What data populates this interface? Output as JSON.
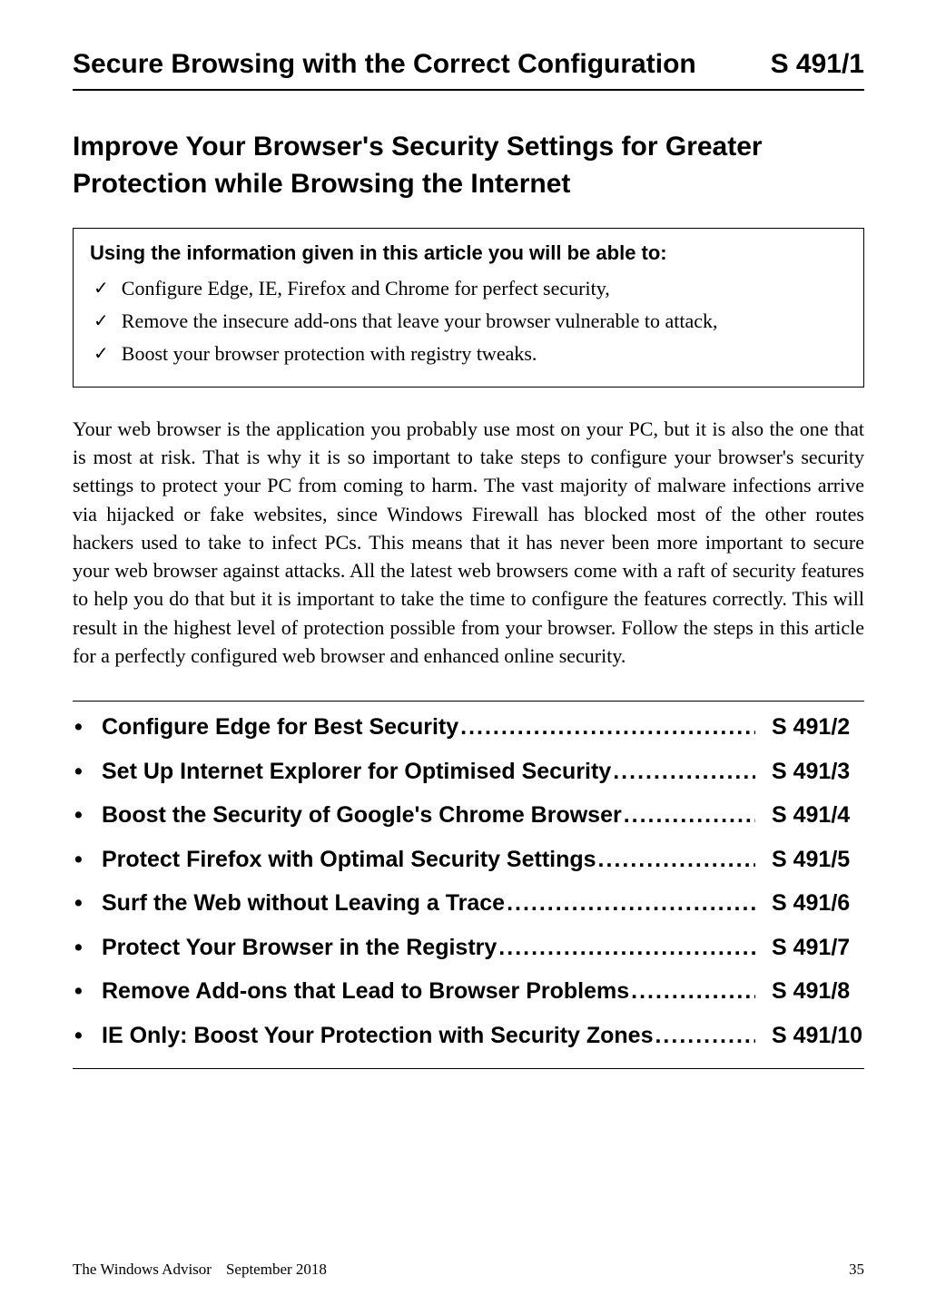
{
  "header": {
    "title": "Secure Browsing with the Correct Configuration",
    "code": "S 491/1"
  },
  "article_title": "Improve Your Browser's Security Settings for Greater Protection while Browsing the Internet",
  "info_box": {
    "title": "Using the information given in this article you will be able to:",
    "items": [
      "Configure Edge, IE, Firefox and Chrome for perfect security,",
      "Remove the insecure add-ons that leave your browser vulnerable to attack,",
      "Boost your browser protection with registry tweaks."
    ]
  },
  "body": "Your web browser is the application you probably use most on your PC, but it is also the one that is most at risk. That is why it is so important to take steps to configure your browser's security settings to protect your PC from coming to harm. The vast majority of malware infections arrive via hijacked or fake websites, since Windows Firewall has blocked most of the other routes hackers used to take to infect PCs. This means that it has never been more important to secure your web browser against attacks. All the latest web browsers come with a raft of security features to help you do that but it is important to take the time to configure the features correctly. This will result in the highest level of protection possible from your browser. Follow the steps in this article for a perfectly configured web browser and enhanced online security.",
  "toc": [
    {
      "label": "Configure Edge for Best Security",
      "page": "S 491/2"
    },
    {
      "label": "Set Up Internet Explorer for Optimised Security",
      "page": "S 491/3"
    },
    {
      "label": "Boost the Security of Google's Chrome Browser",
      "page": "S 491/4"
    },
    {
      "label": "Protect Firefox with Optimal Security Settings",
      "page": "S 491/5"
    },
    {
      "label": "Surf the Web without Leaving a Trace",
      "page": "S 491/6"
    },
    {
      "label": "Protect Your Browser in the Registry",
      "page": "S 491/7"
    },
    {
      "label": "Remove Add-ons that Lead to Browser Problems",
      "page": "S 491/8"
    },
    {
      "label": "IE Only: Boost Your Protection with Security Zones",
      "page": "S 491/10"
    }
  ],
  "footer": {
    "publication": "The Windows Advisor",
    "date": "September 2018",
    "page_number": "35"
  }
}
